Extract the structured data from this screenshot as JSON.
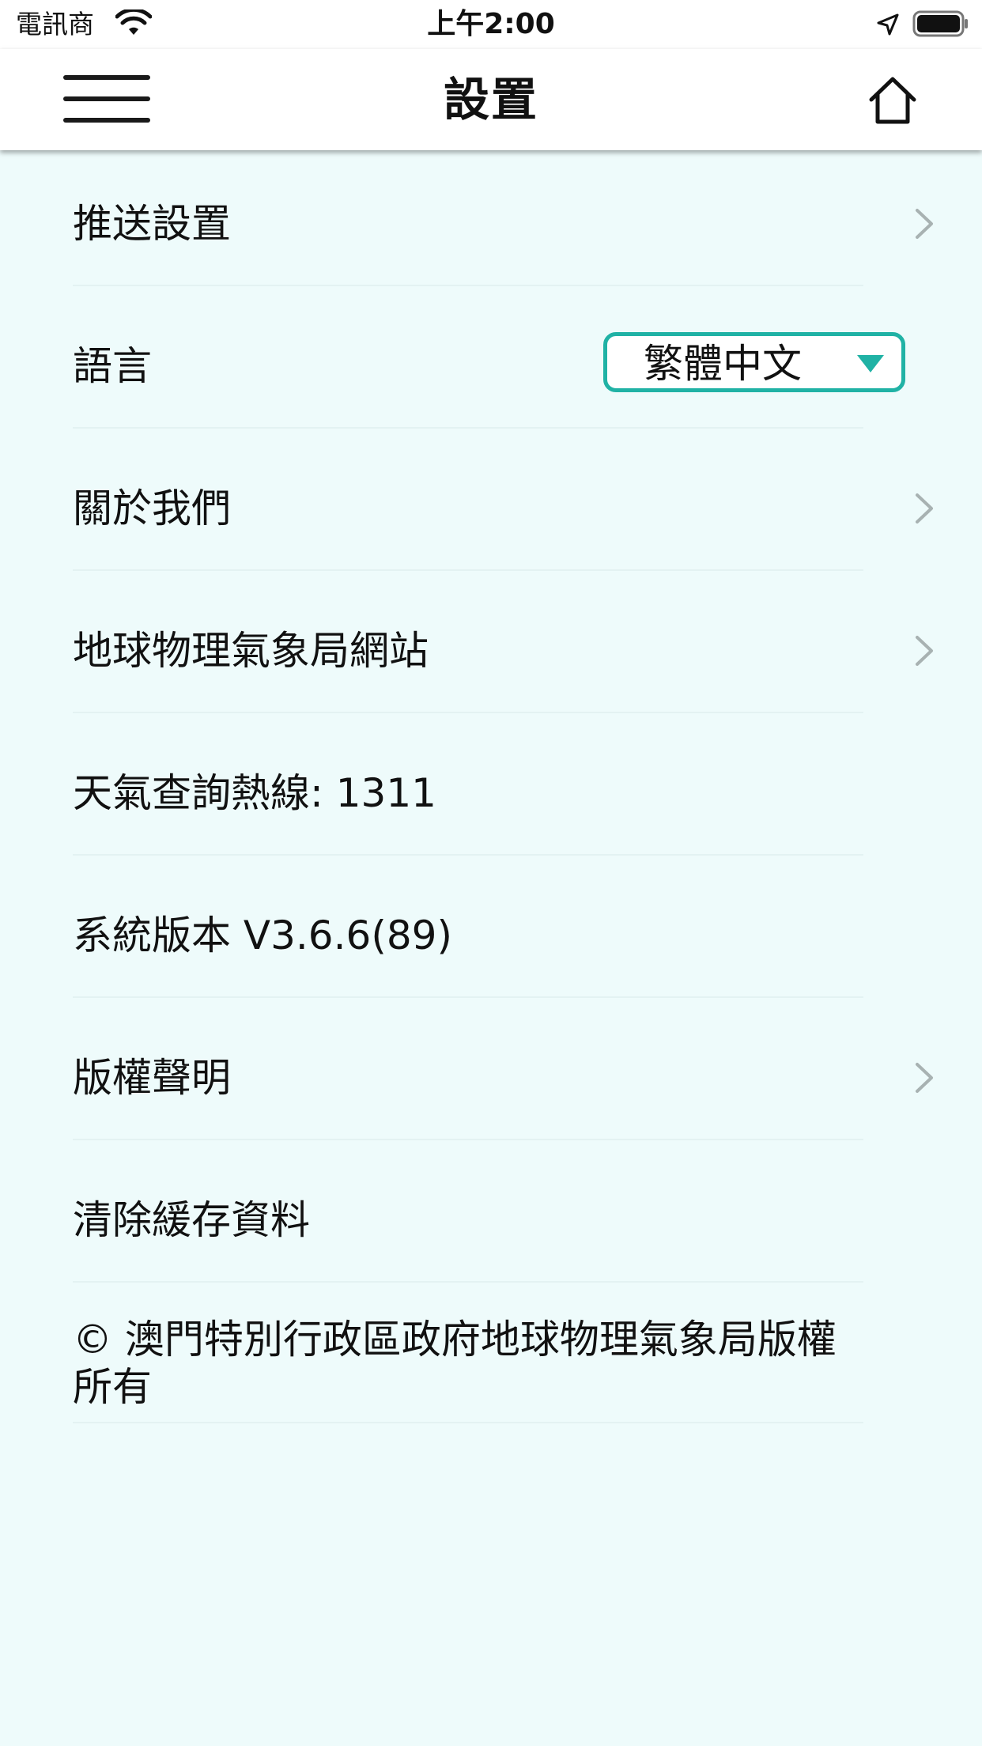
{
  "status_bar": {
    "carrier": "電訊商",
    "time": "上午2:00"
  },
  "nav": {
    "title": "設置"
  },
  "settings": {
    "push": "推送設置",
    "language_label": "語言",
    "language_value": "繁體中文",
    "about": "關於我們",
    "website": "地球物理氣象局網站",
    "hotline": "天氣查詢熱線: 1311",
    "version": "系統版本 V3.6.6(89)",
    "copyright_notice": "版權聲明",
    "clear_cache": "清除緩存資料",
    "footer": "© 澳門特別行政區政府地球物理氣象局版權所有"
  },
  "colors": {
    "background": "#eefbfb",
    "accent": "#20b2a5"
  }
}
